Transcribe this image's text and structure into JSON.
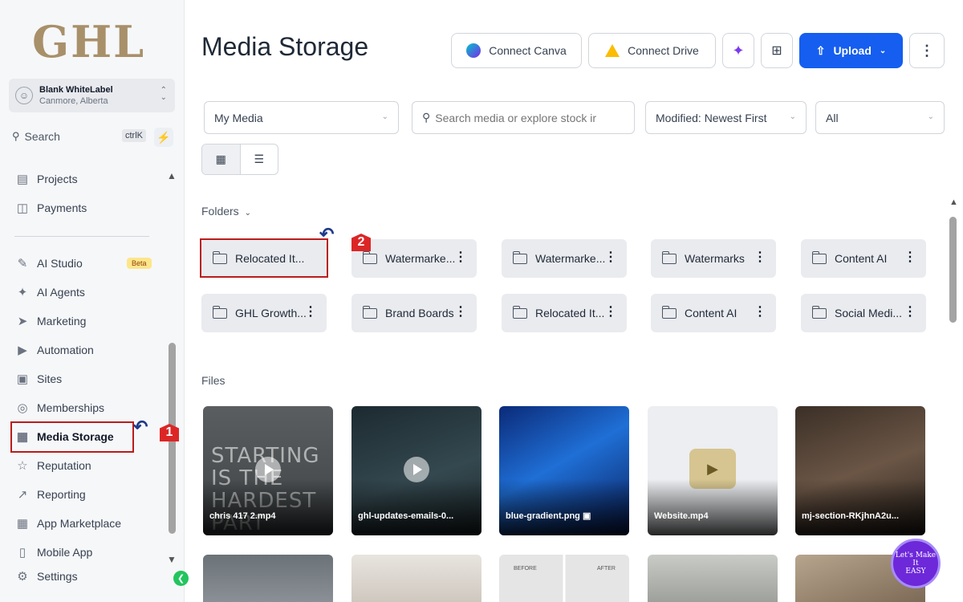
{
  "sidebar": {
    "logo": "GHL",
    "account": {
      "name": "Blank WhiteLabel",
      "location": "Canmore, Alberta"
    },
    "search": {
      "label": "Search",
      "shortcut": "ctrlK"
    },
    "items": [
      {
        "label": "Projects",
        "icon": "clipboard-icon"
      },
      {
        "label": "Payments",
        "icon": "receipt-icon"
      },
      {
        "label": "AI Studio",
        "icon": "ai-studio-icon",
        "badge": "Beta"
      },
      {
        "label": "AI Agents",
        "icon": "sparkle-icon"
      },
      {
        "label": "Marketing",
        "icon": "send-icon"
      },
      {
        "label": "Automation",
        "icon": "play-circle-icon"
      },
      {
        "label": "Sites",
        "icon": "browser-icon"
      },
      {
        "label": "Memberships",
        "icon": "award-icon"
      },
      {
        "label": "Media Storage",
        "icon": "image-icon",
        "active": true
      },
      {
        "label": "Reputation",
        "icon": "star-icon"
      },
      {
        "label": "Reporting",
        "icon": "trend-icon"
      },
      {
        "label": "App Marketplace",
        "icon": "grid-icon"
      },
      {
        "label": "Mobile App",
        "icon": "phone-icon"
      },
      {
        "label": "Settings",
        "icon": "gear-icon"
      }
    ]
  },
  "annotations": {
    "marker1": "1",
    "marker2": "2"
  },
  "header": {
    "title": "Media Storage",
    "connect_canva": "Connect Canva",
    "connect_drive": "Connect Drive",
    "upload": "Upload"
  },
  "filters": {
    "source": "My Media",
    "search_placeholder": "Search media or explore stock ir",
    "sort": "Modified: Newest First",
    "type": "All"
  },
  "folders_label": "Folders",
  "folders": [
    "Relocated It...",
    "Watermarke...",
    "Watermarke...",
    "Watermarks",
    "Content AI",
    "GHL Growth...",
    "Brand Boards",
    "Relocated It...",
    "Content AI",
    "Social Medi..."
  ],
  "files_label": "Files",
  "files": [
    {
      "name": "chris 417 2.mp4",
      "overlay_text": "STARTING IS THE HARDEST PART"
    },
    {
      "name": "ghl-updates-emails-0..."
    },
    {
      "name": "blue-gradient.png"
    },
    {
      "name": "Website.mp4"
    },
    {
      "name": "mj-section-RKjhnA2u..."
    }
  ],
  "files_row2_labels": {
    "before": "BEFORE",
    "after": "AFTER"
  },
  "badge": {
    "line1": "Let's Make",
    "line2": "It",
    "line3": "EASY"
  },
  "colors": {
    "accent": "#155eef",
    "highlight": "#b91c1c",
    "brand_logo": "#a8906a"
  }
}
